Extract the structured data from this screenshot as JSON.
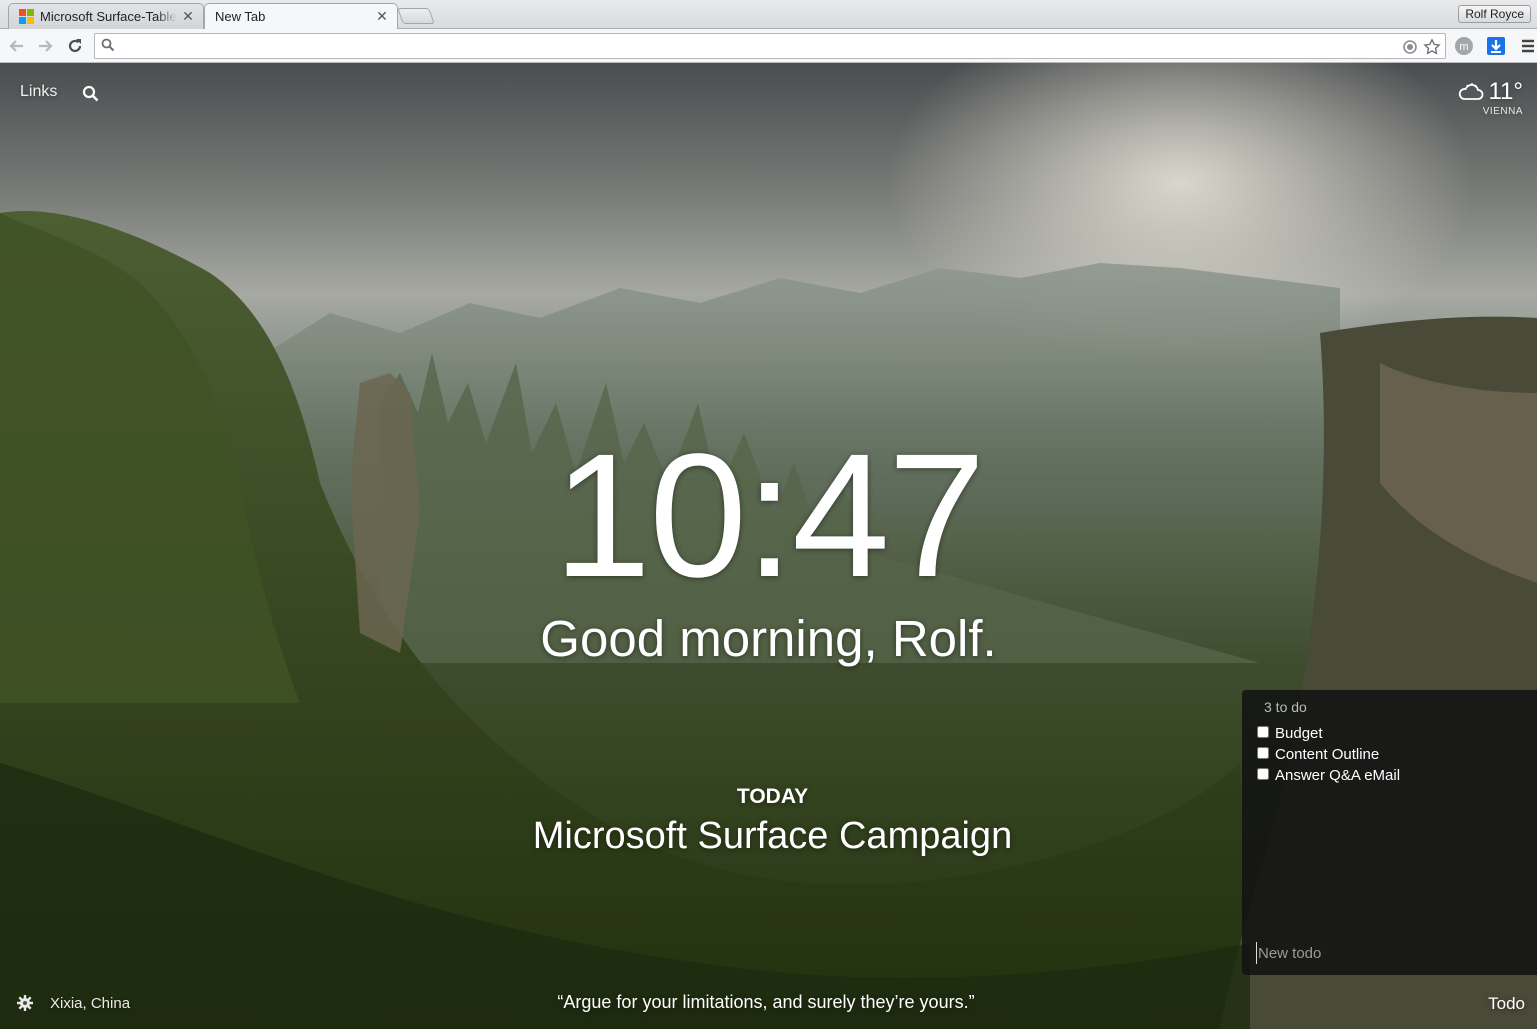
{
  "browser": {
    "tabs": [
      {
        "title": "Microsoft Surface-Tablet",
        "active": false
      },
      {
        "title": "New Tab",
        "active": true
      }
    ],
    "profile_name": "Rolf Royce",
    "omnibox_value": "",
    "icons": {
      "back": "arrow-left-icon",
      "forward": "arrow-right-icon",
      "reload": "reload-icon",
      "bookmark": "star-icon",
      "extension": "circle-m-icon",
      "download": "download-arrow-icon",
      "menu": "hamburger-icon"
    }
  },
  "dashboard": {
    "links_label": "Links",
    "weather": {
      "temperature": "11°",
      "location": "VIENNA",
      "icon": "cloud-icon"
    },
    "clock": "10:47",
    "greeting": "Good morning, Rolf.",
    "focus": {
      "label": "TODAY",
      "text": "Microsoft Surface Campaign"
    },
    "photo_location": "Xixia, China",
    "quote": "“Argue for your limitations, and surely they’re yours.”",
    "todo_link": "Todo",
    "todo": {
      "count_label": "3 to do",
      "items": [
        {
          "text": "Budget",
          "done": false
        },
        {
          "text": "Content Outline",
          "done": false
        },
        {
          "text": "Answer Q&A eMail",
          "done": false
        }
      ],
      "new_placeholder": "New todo"
    }
  },
  "colors": {
    "todo_panel_bg": "#121212",
    "download_icon": "#1a73e8"
  }
}
